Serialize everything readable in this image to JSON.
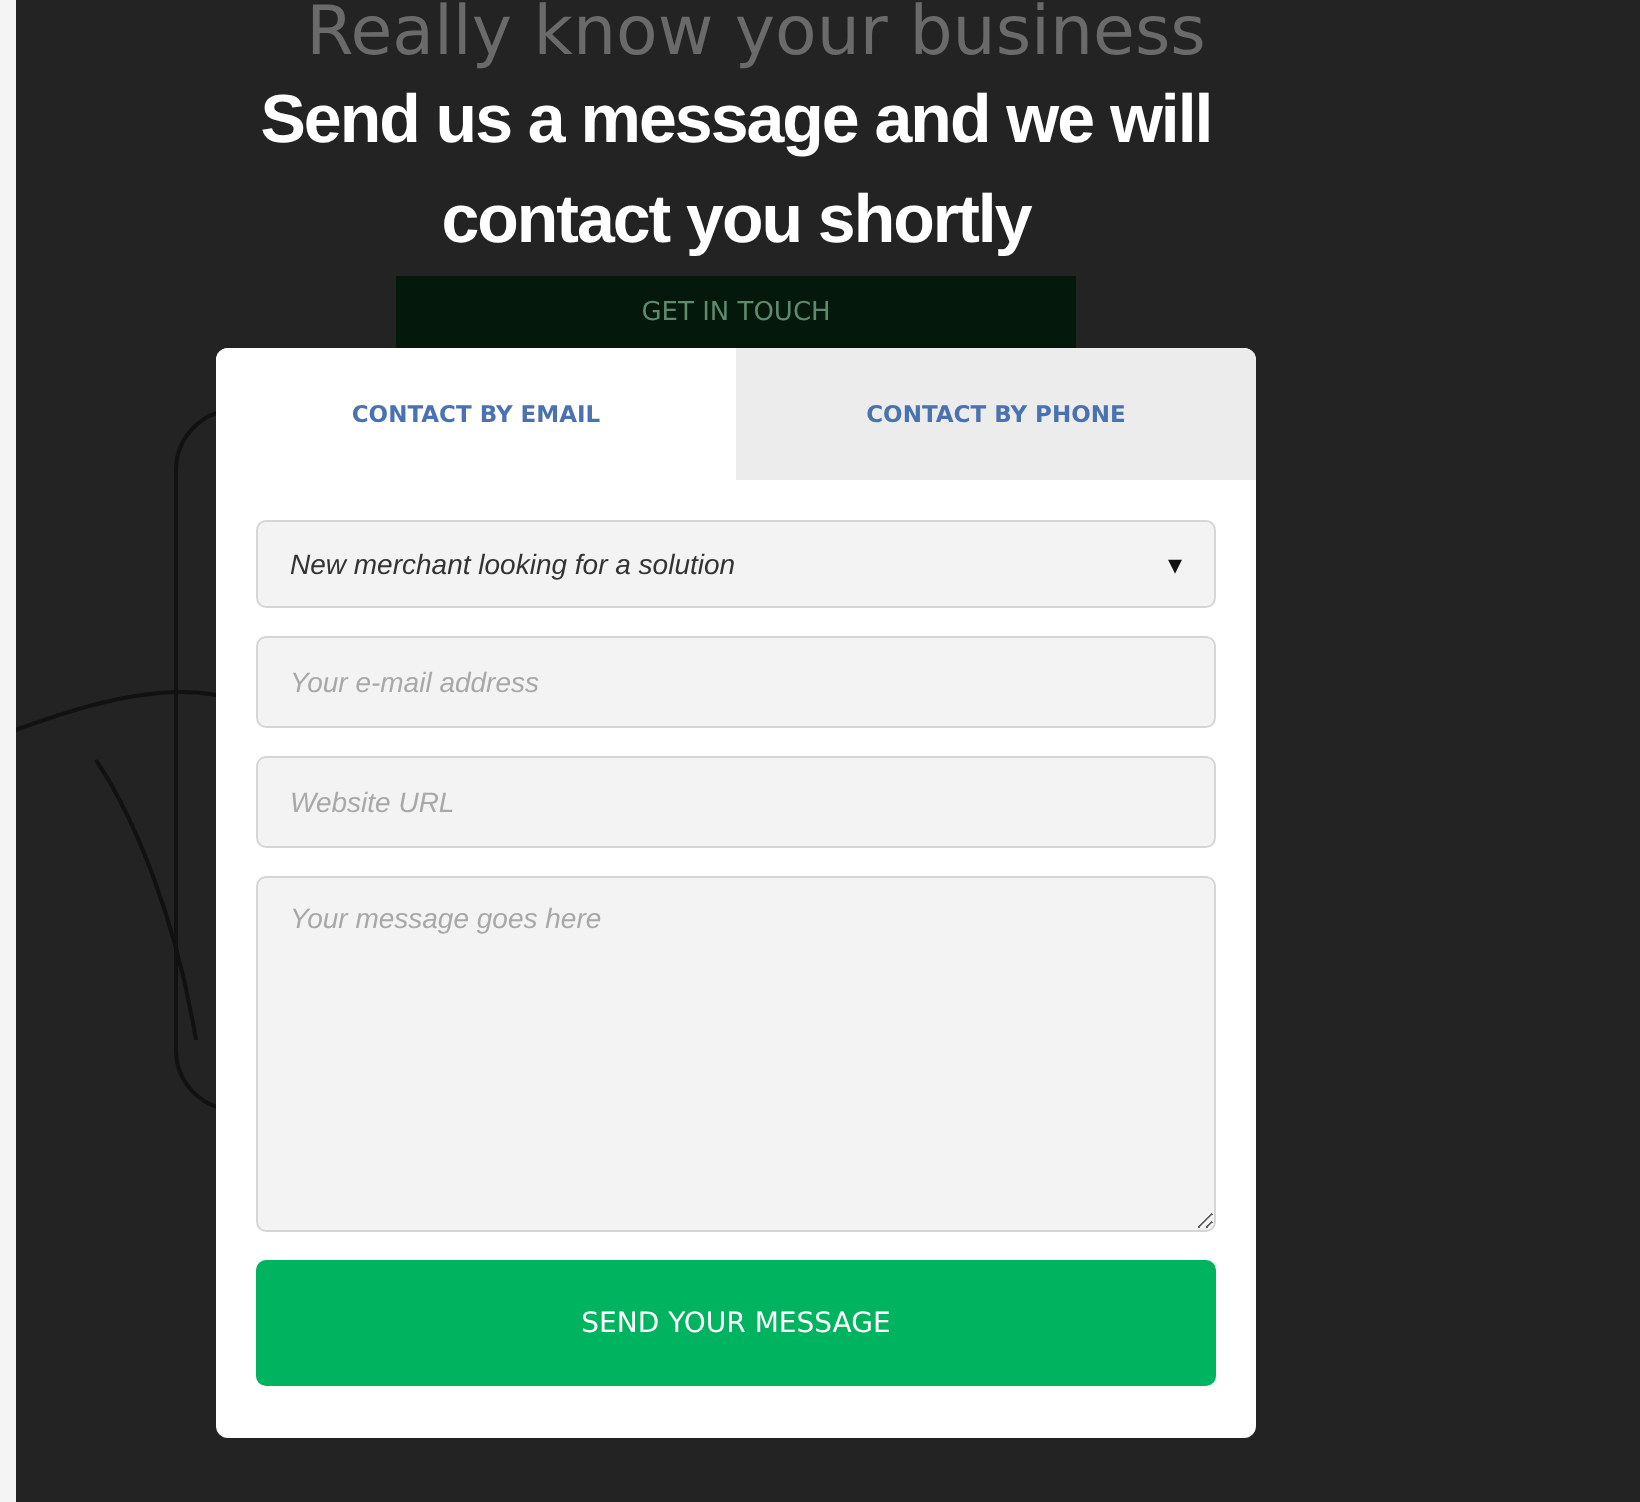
{
  "background": {
    "heading": "Really know your business",
    "button": "GET IN TOUCH"
  },
  "modal": {
    "title": "Send us a message and we will contact you shortly",
    "tabs": [
      {
        "label": "CONTACT BY EMAIL",
        "selected": true
      },
      {
        "label": "CONTACT BY PHONE",
        "selected": false
      }
    ],
    "topic_select": {
      "value": "New merchant looking for a solution",
      "arrow": "▾"
    },
    "email_field": {
      "placeholder": "Your e-mail address"
    },
    "url_field": {
      "placeholder": "Website URL"
    },
    "message_field": {
      "placeholder": "Your message goes here"
    },
    "submit": "SEND YOUR MESSAGE"
  }
}
